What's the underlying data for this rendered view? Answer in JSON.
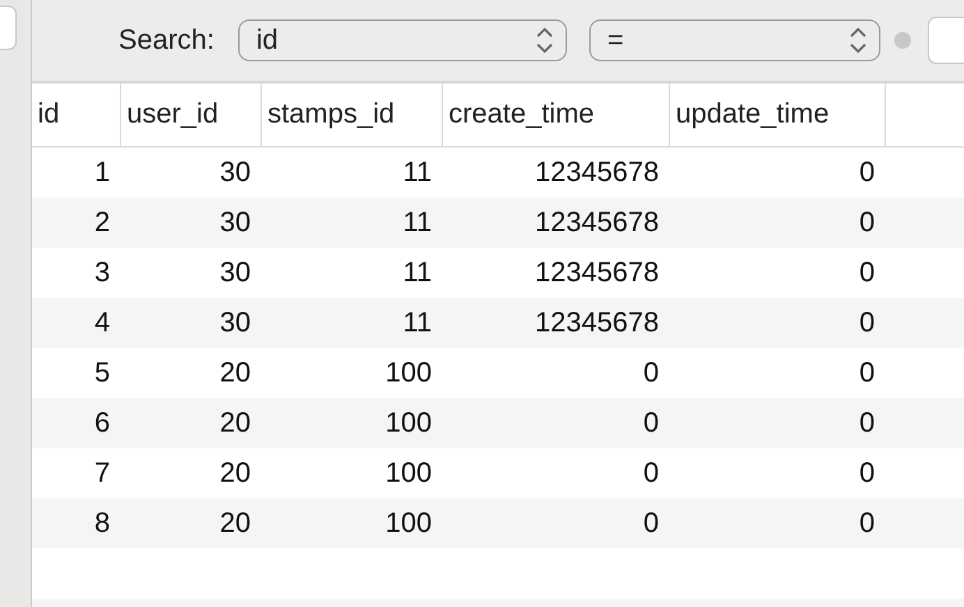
{
  "search": {
    "label": "Search:",
    "field": "id",
    "operator": "="
  },
  "table": {
    "columns": [
      "id",
      "user_id",
      "stamps_id",
      "create_time",
      "update_time"
    ],
    "rows": [
      [
        "1",
        "30",
        "11",
        "12345678",
        "0"
      ],
      [
        "2",
        "30",
        "11",
        "12345678",
        "0"
      ],
      [
        "3",
        "30",
        "11",
        "12345678",
        "0"
      ],
      [
        "4",
        "30",
        "11",
        "12345678",
        "0"
      ],
      [
        "5",
        "20",
        "100",
        "0",
        "0"
      ],
      [
        "6",
        "20",
        "100",
        "0",
        "0"
      ],
      [
        "7",
        "20",
        "100",
        "0",
        "0"
      ],
      [
        "8",
        "20",
        "100",
        "0",
        "0"
      ]
    ]
  }
}
